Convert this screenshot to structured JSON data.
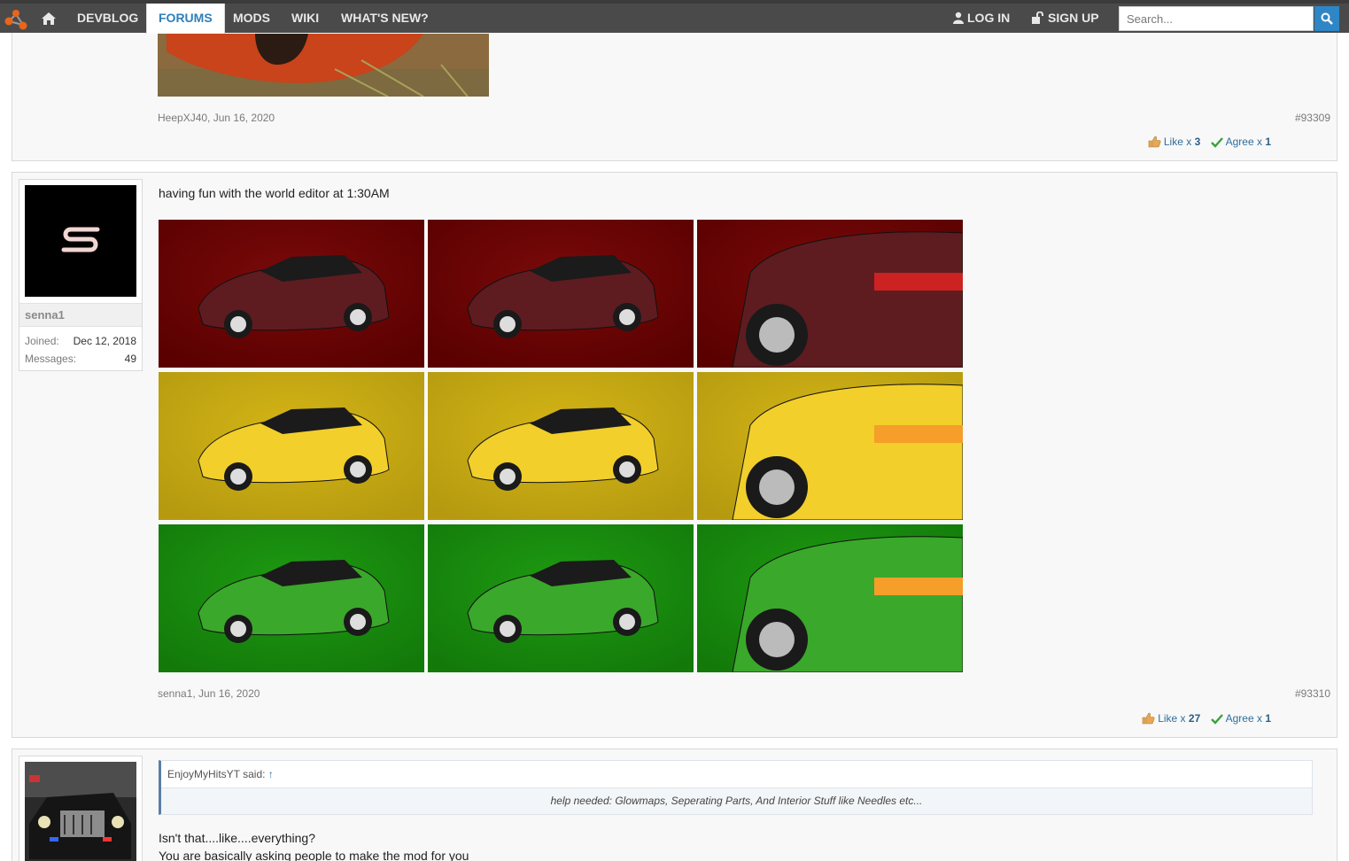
{
  "nav": {
    "items": [
      "DEVBLOG",
      "FORUMS",
      "MODS",
      "WIKI",
      "WHAT'S NEW?"
    ],
    "active": "FORUMS",
    "login": "LOG IN",
    "signup": "SIGN UP",
    "search_placeholder": "Search...",
    "accent": "#2f86c6"
  },
  "post_prev": {
    "author_date": "HeepXJ40, Jun 16, 2020",
    "permalink": "#93309",
    "like_label": "Like x",
    "like_count": "3",
    "agree_label": "Agree x",
    "agree_count": "1"
  },
  "post_main": {
    "user": {
      "name": "senna1",
      "joined_label": "Joined:",
      "joined": "Dec 12, 2018",
      "messages_label": "Messages:",
      "messages": "49"
    },
    "text": "having fun with the world editor at 1:30AM",
    "images": [
      {
        "name": "red-car-front",
        "color": "#7a0a0a"
      },
      {
        "name": "red-car-rear",
        "color": "#7a0a0a"
      },
      {
        "name": "red-car-closeup",
        "color": "#7a0a0a"
      },
      {
        "name": "yellow-car-front",
        "color": "#d4b516"
      },
      {
        "name": "yellow-car-rear",
        "color": "#d4b516"
      },
      {
        "name": "yellow-car-closeup",
        "color": "#d4b516"
      },
      {
        "name": "green-car-front",
        "color": "#1e9a12"
      },
      {
        "name": "green-car-rear",
        "color": "#1e9a12"
      },
      {
        "name": "green-car-closeup",
        "color": "#1e9a12"
      }
    ],
    "author_date": "senna1, Jun 16, 2020",
    "permalink": "#93310",
    "like_label": "Like x",
    "like_count": "27",
    "agree_label": "Agree x",
    "agree_count": "1"
  },
  "post_next": {
    "quote_author": "EnjoyMyHitsYT said:",
    "quote_arrow": "↑",
    "quote_text": "help needed: Glowmaps, Seperating Parts, And Interior Stuff like Needles etc...",
    "line1": "Isn't that....like....everything?",
    "line2": "You are basically asking people to make the mod for you"
  }
}
